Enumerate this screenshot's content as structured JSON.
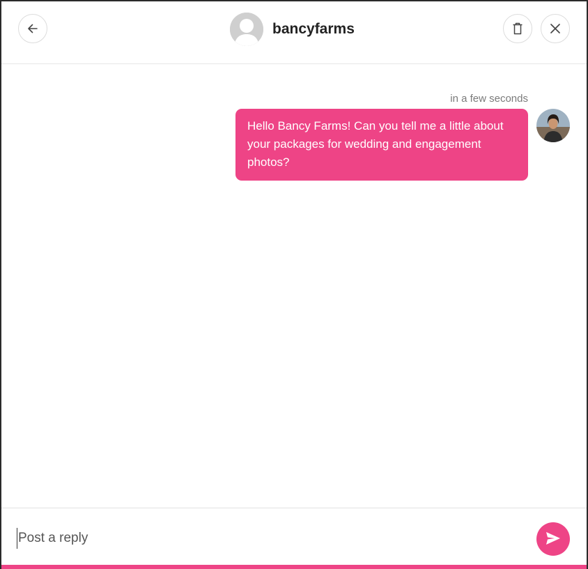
{
  "header": {
    "username": "bancyfarms",
    "icons": {
      "back": "arrow-left-icon",
      "delete": "trash-icon",
      "close": "close-icon",
      "avatar": "default-user-avatar"
    }
  },
  "messages": [
    {
      "time": "in a few seconds",
      "text": "Hello Bancy Farms! Can you tell me a little about your packages for wedding and engagement photos?",
      "sender_avatar": "user-photo-avatar"
    }
  ],
  "reply": {
    "placeholder": "Post a reply",
    "send_icon": "send-icon"
  },
  "colors": {
    "accent": "#ee4486",
    "avatar_placeholder": "#cfcfcf"
  }
}
